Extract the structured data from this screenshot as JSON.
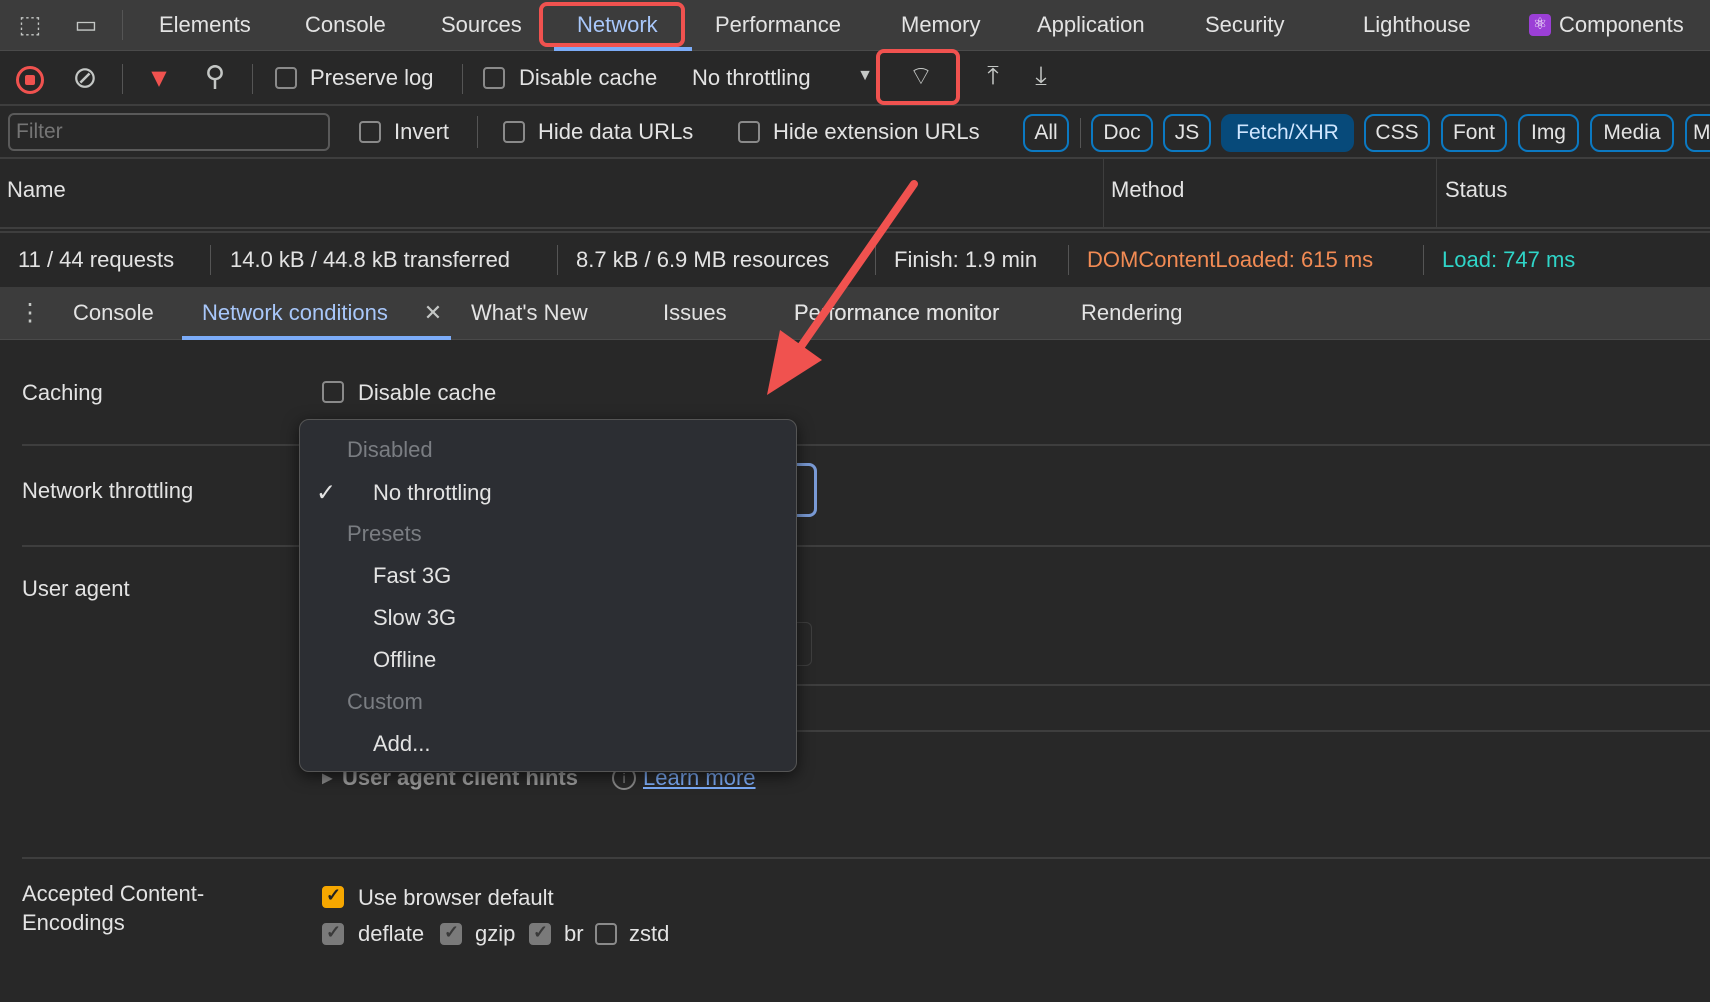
{
  "top_tabs": [
    "Elements",
    "Console",
    "Sources",
    "Network",
    "Performance",
    "Memory",
    "Application",
    "Security",
    "Lighthouse",
    "Components"
  ],
  "active_tab": "Network",
  "toolbar": {
    "preserve_log": "Preserve log",
    "disable_cache": "Disable cache",
    "throttling": "No throttling"
  },
  "filter": {
    "placeholder": "Filter",
    "invert": "Invert",
    "hide_data_urls": "Hide data URLs",
    "hide_extension_urls": "Hide extension URLs",
    "chips": [
      "All",
      "Doc",
      "JS",
      "Fetch/XHR",
      "CSS",
      "Font",
      "Img",
      "Media",
      "M"
    ],
    "selected_chip": "Fetch/XHR"
  },
  "table": {
    "columns": [
      "Name",
      "Method",
      "Status"
    ]
  },
  "summary": {
    "requests": "11 / 44 requests",
    "transferred": "14.0 kB / 44.8 kB transferred",
    "resources": "8.7 kB / 6.9 MB resources",
    "finish": "Finish: 1.9 min",
    "dcl": "DOMContentLoaded: 615 ms",
    "load": "Load: 747 ms",
    "dcl_color": "#f28b54",
    "load_color": "#2fd5c8"
  },
  "drawer": {
    "tabs": [
      "Console",
      "Network conditions",
      "What's New",
      "Issues",
      "Performance monitor",
      "Rendering"
    ],
    "active": "Network conditions",
    "visible_perf": "P         ormance monitor"
  },
  "conditions": {
    "caching_label": "Caching",
    "disable_cache": "Disable cache",
    "throttling_label": "Network throttling",
    "user_agent_label": "User agent",
    "ua_hints": "User agent client hints",
    "learn_more": "Learn more",
    "encodings_label_1": "Accepted Content-",
    "encodings_label_2": "Encodings",
    "use_browser_default": "Use browser default",
    "encodings": [
      {
        "name": "deflate",
        "checked": true
      },
      {
        "name": "gzip",
        "checked": true
      },
      {
        "name": "br",
        "checked": true
      },
      {
        "name": "zstd",
        "checked": false
      }
    ]
  },
  "throttle_menu": {
    "groups": [
      {
        "label": "Disabled",
        "items": [
          "No throttling"
        ]
      },
      {
        "label": "Presets",
        "items": [
          "Fast 3G",
          "Slow 3G",
          "Offline"
        ]
      },
      {
        "label": "Custom",
        "items": [
          "Add..."
        ]
      }
    ],
    "selected": "No throttling"
  },
  "annotation_color": "#f0524f"
}
